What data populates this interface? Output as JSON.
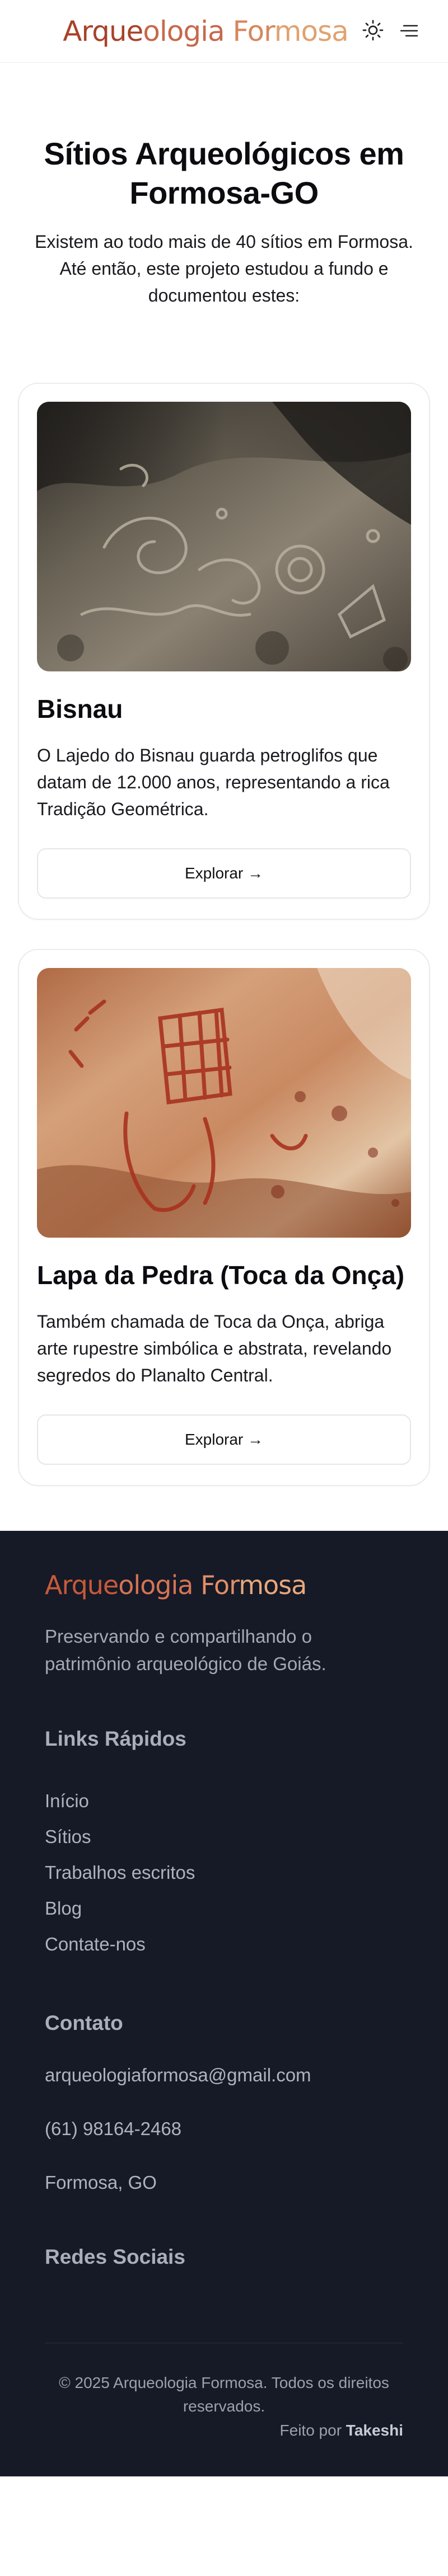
{
  "header": {
    "logo": [
      "Arque",
      "ologia",
      " For",
      "mosa"
    ],
    "theme_icon": "sun-icon",
    "menu_icon": "menu-icon"
  },
  "hero": {
    "title": "Sítios Arqueológicos em Formosa-GO",
    "description": "Existem ao todo mais de 40 sítios em Formosa. Até então, este projeto estudou a fundo e documentou estes:"
  },
  "sites": [
    {
      "title": "Bisnau",
      "description": "O Lajedo do Bisnau guarda petroglifos que datam de 12.000 anos, representando a rica Tradição Geométrica.",
      "button": "Explorar →"
    },
    {
      "title": "Lapa da Pedra (Toca da Onça)",
      "description": "Também chamada de Toca da Onça, abriga arte rupestre simbólica e abstrata, revelando segredos do Planalto Central.",
      "button": "Explorar →"
    }
  ],
  "footer": {
    "logo": [
      "Arque",
      "ologia",
      " For",
      "mosa"
    ],
    "tagline": "Preservando e compartilhando o patrimônio arqueológico de Goiás.",
    "quick_links_title": "Links Rápidos",
    "quick_links": [
      "Início",
      "Sítios",
      "Trabalhos escritos",
      "Blog",
      "Contate-nos"
    ],
    "contact_title": "Contato",
    "email": "arqueologiaformosa@gmail.com",
    "phone": "(61) 98164-2468",
    "location": "Formosa, GO",
    "social_title": "Redes Sociais",
    "copyright": "© 2025 Arqueologia Formosa. Todos os direitos reservados.",
    "made_by_prefix": "Feito por",
    "made_by_name": "Takeshi"
  },
  "colors": {
    "logo_dark": "#a8422a",
    "logo_light": "#e0a270",
    "footer_bg": "#161926"
  }
}
